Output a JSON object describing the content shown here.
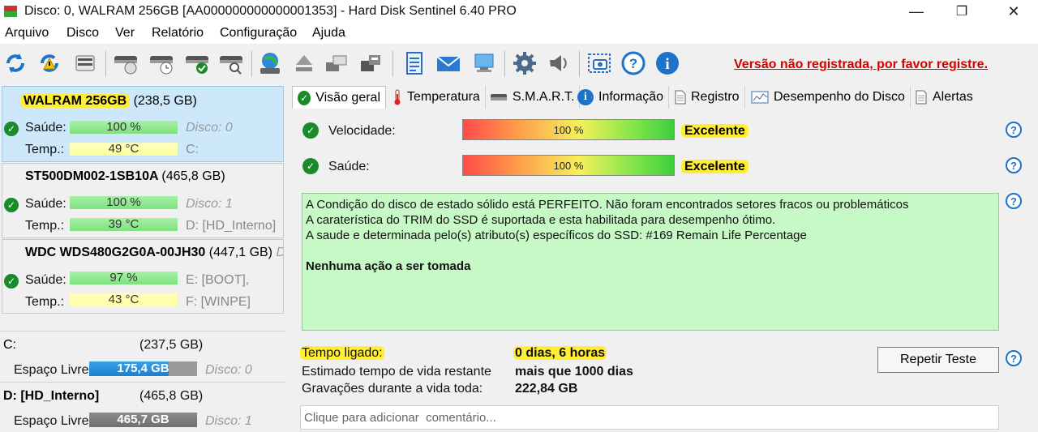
{
  "window": {
    "title": "Disco: 0, WALRAM 256GB [AA000000000000001353]  -  Hard Disk Sentinel 6.40 PRO",
    "minimize": "—",
    "restore": "❐",
    "close": "✕"
  },
  "menu": [
    {
      "label": "Arquivo"
    },
    {
      "label": "Disco"
    },
    {
      "label": "Ver"
    },
    {
      "label": "Relatório"
    },
    {
      "label": "Configuração"
    },
    {
      "label": "Ajuda"
    }
  ],
  "toolbar": {
    "registration_link": "Versão não registrada, por favor registre."
  },
  "disks": [
    {
      "name": "WALRAM 256GB",
      "size": "(238,5 GB)",
      "health_label": "Saúde:",
      "health_value": "100 %",
      "temp_label": "Temp.:",
      "temp_value": "49 °C",
      "disk_ref": "Disco: 0",
      "volume_ref": "C:"
    },
    {
      "name": "ST500DM002-1SB10A",
      "size": "(465,8 GB)",
      "health_label": "Saúde:",
      "health_value": "100 %",
      "temp_label": "Temp.:",
      "temp_value": "39 °C",
      "disk_ref": "Disco: 1",
      "volume_ref": "D: [HD_Interno]"
    },
    {
      "name": "WDC WDS480G2G0A-00JH30",
      "size": "(447,1 GB)",
      "trailing": "Dis",
      "health_label": "Saúde:",
      "health_value": "97 %",
      "temp_label": "Temp.:",
      "temp_value": "43 °C",
      "disk_ref": "E: [BOOT],",
      "volume_ref": "F: [WINPE]"
    }
  ],
  "volumes": [
    {
      "name": "C:",
      "size": "(237,5 GB)",
      "free_label": "Espaço Livre",
      "free_value": "175,4 GB",
      "disk_ref": "Disco: 0",
      "free_fraction": 0.74
    },
    {
      "name": "D: [HD_Interno]",
      "size": "(465,8 GB)",
      "free_label": "Espaço Livre",
      "free_value": "465,7 GB",
      "disk_ref": "Disco: 1",
      "free_fraction": 1.0
    }
  ],
  "tabs": [
    {
      "label": "Visão geral",
      "icon": "check-icon"
    },
    {
      "label": "Temperatura",
      "icon": "thermometer-icon"
    },
    {
      "label": "S.M.A.R.T.",
      "icon": "smart-icon"
    },
    {
      "label": "Informação",
      "icon": "info-icon"
    },
    {
      "label": "Registro",
      "icon": "document-icon"
    },
    {
      "label": "Desempenho do Disco",
      "icon": "performance-icon"
    },
    {
      "label": "Alertas",
      "icon": "alerts-icon"
    }
  ],
  "overview": {
    "speed_label": "Velocidade:",
    "speed_value": "100 %",
    "speed_fraction": 1.0,
    "speed_verdict": "Excelente",
    "health_label": "Saúde:",
    "health_value": "100 %",
    "health_fraction": 1.0,
    "health_verdict": "Excelente",
    "info_lines": [
      "A Condição do disco de estado sólido está PERFEITO. Não foram encontrados setores fracos ou problemáticos",
      "A caraterística do TRIM do SSD é suportada e esta habilitada para desempenho ótimo.",
      "A saude e determinada pelo(s) atributo(s) específicos do SSD: #169 Remain Life Percentage"
    ],
    "info_action": "Nenhuma ação a ser tomada",
    "power_on_label": "Tempo ligado:",
    "power_on_value": "0 dias, 6 horas",
    "lifetime_label": "Estimado tempo de vida restante",
    "lifetime_value": "mais que 1000 dias",
    "writes_label": "Gravações durante a vida toda:",
    "writes_value": "222,84 GB",
    "retest_button": "Repetir Teste",
    "comment_placeholder": "Clique para adicionar  comentário..."
  },
  "colors": {
    "accent": "#1d73c9",
    "registration": "#d40000",
    "info_bg": "#c6f9c6",
    "highlight": "#ffee33"
  }
}
